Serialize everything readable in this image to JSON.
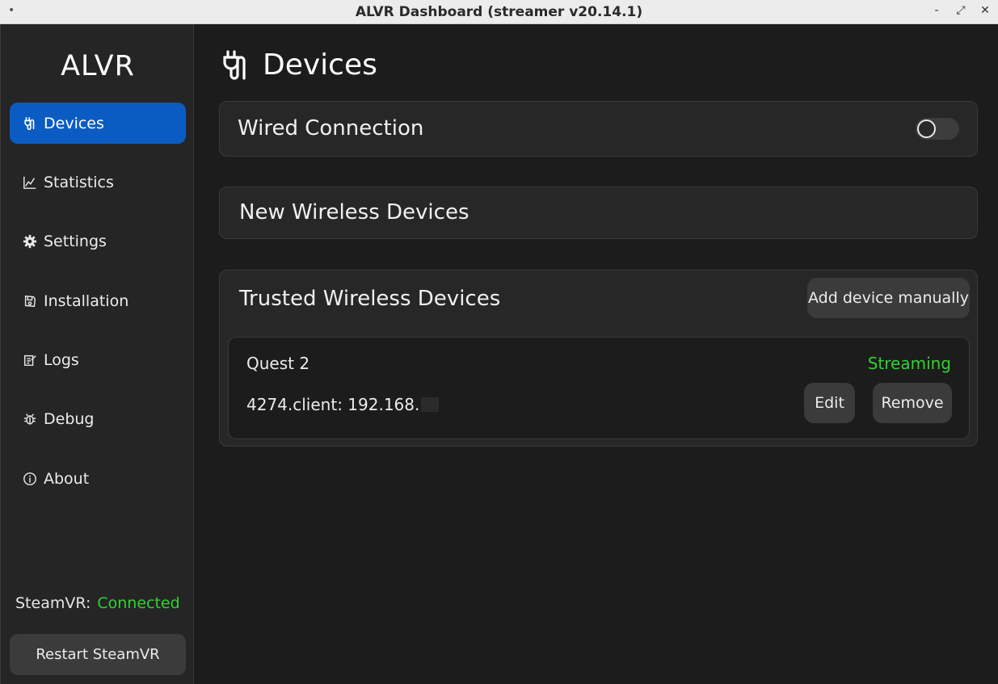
{
  "window": {
    "title": "ALVR Dashboard (streamer v20.14.1)",
    "controls": [
      "-",
      "⤢",
      "✕"
    ]
  },
  "sidebar": {
    "brand": "ALVR",
    "items": [
      {
        "label": "Devices",
        "icon": "plug-icon",
        "active": true
      },
      {
        "label": "Statistics",
        "icon": "chart-line-icon",
        "active": false
      },
      {
        "label": "Settings",
        "icon": "gear-icon",
        "active": false
      },
      {
        "label": "Installation",
        "icon": "floppy-icon",
        "active": false
      },
      {
        "label": "Logs",
        "icon": "notepad-icon",
        "active": false
      },
      {
        "label": "Debug",
        "icon": "bug-icon",
        "active": false
      },
      {
        "label": "About",
        "icon": "info-icon",
        "active": false
      }
    ],
    "steamvr_label": "SteamVR:",
    "steamvr_status": "Connected",
    "restart_label": "Restart SteamVR"
  },
  "main": {
    "page_title": "Devices",
    "wired": {
      "title": "Wired Connection",
      "enabled": false
    },
    "new_wireless": {
      "title": "New Wireless Devices"
    },
    "trusted": {
      "title": "Trusted Wireless Devices",
      "add_label": "Add device manually",
      "devices": [
        {
          "name": "Quest 2",
          "status": "Streaming",
          "address": "4274.client: 192.168.",
          "edit_label": "Edit",
          "remove_label": "Remove"
        }
      ]
    }
  },
  "colors": {
    "accent": "#0b5cc2",
    "status_ok": "#2fd32f",
    "background": "#1c1c1c",
    "panel": "#272727"
  }
}
